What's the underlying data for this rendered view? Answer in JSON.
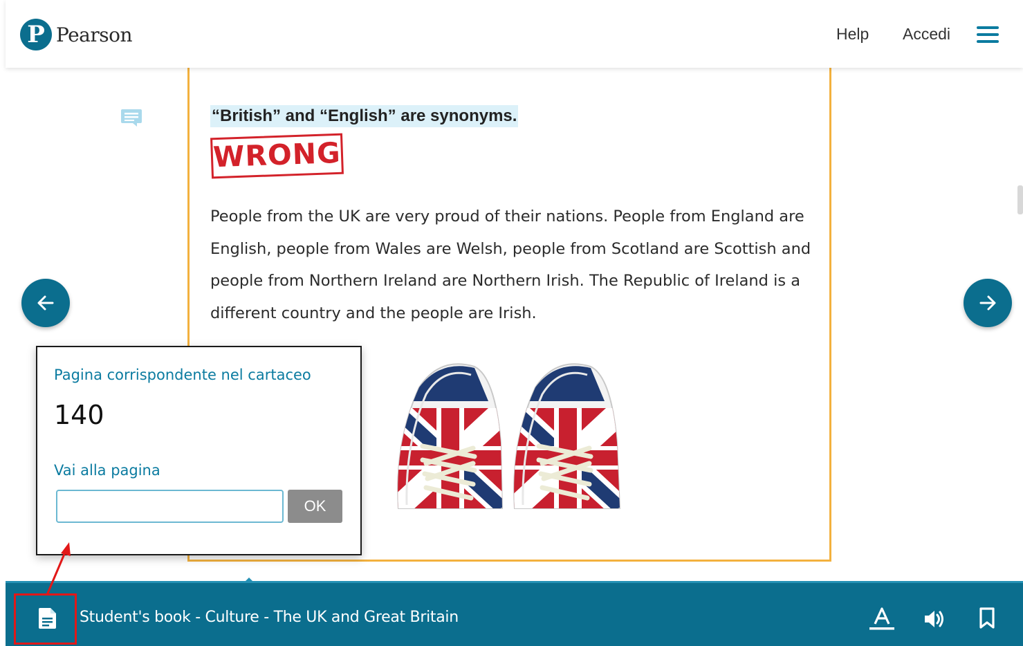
{
  "header": {
    "brand": "Pearson",
    "logo_letter": "P",
    "help_label": "Help",
    "login_label": "Accedi",
    "menu_icon": "hamburger-menu-icon"
  },
  "page": {
    "statement": "“British” and “English” are synonyms.",
    "stamp_text": "WRONG",
    "body_text": "People from the UK are very proud of their nations. People from England are English, people from Wales are Welsh, people from Scotland are Scottish and people from Northern Ireland are Northern Irish. The Republic of Ireland is a different country and the people are Irish.",
    "image_description": "union-jack-sneakers-illustration"
  },
  "popup": {
    "print_page_label": "Pagina corrispondente nel cartaceo",
    "print_page_number": "140",
    "goto_label": "Vai alla pagina",
    "goto_value": "",
    "ok_label": "OK"
  },
  "bottom_bar": {
    "title": "Student's book - Culture - The UK and Great Britain",
    "icons": [
      "document-icon",
      "font-size-icon",
      "audio-icon",
      "bookmark-icon"
    ]
  },
  "colors": {
    "brand_teal": "#0b6e8e",
    "accent_blue": "#0b7ba0",
    "page_border": "#f3b13e",
    "stamp_red": "#d3222a",
    "highlight": "#dcf1f9",
    "annotation_red": "#e21818"
  }
}
